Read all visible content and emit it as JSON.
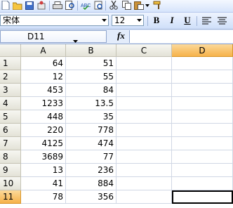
{
  "toolbar": {
    "icons": [
      "new-icon",
      "open-icon",
      "save-icon",
      "permission-icon",
      "print-icon",
      "print-preview-icon",
      "spelling-icon",
      "research-icon",
      "cut-icon",
      "copy-icon",
      "paste-icon",
      "format-painter-icon"
    ]
  },
  "format_bar": {
    "font_name": "宋体",
    "font_size": "12",
    "bold_label": "B",
    "italic_label": "I",
    "underline_label": "U"
  },
  "formula_bar": {
    "name_box": "D11",
    "fx_label": "fx",
    "value": ""
  },
  "sheet": {
    "columns": [
      "A",
      "B",
      "C",
      "D"
    ],
    "selected_column": "D",
    "rows": [
      {
        "num": "1",
        "a": "64",
        "b": "51"
      },
      {
        "num": "2",
        "a": "12",
        "b": "55"
      },
      {
        "num": "3",
        "a": "453",
        "b": "84"
      },
      {
        "num": "4",
        "a": "1233",
        "b": "13.5"
      },
      {
        "num": "5",
        "a": "448",
        "b": "35"
      },
      {
        "num": "6",
        "a": "220",
        "b": "778"
      },
      {
        "num": "7",
        "a": "4125",
        "b": "474"
      },
      {
        "num": "8",
        "a": "3689",
        "b": "77"
      },
      {
        "num": "9",
        "a": "13",
        "b": "236"
      },
      {
        "num": "10",
        "a": "41",
        "b": "884"
      },
      {
        "num": "11",
        "a": "78",
        "b": "356"
      }
    ],
    "selected_row": "11",
    "active_cell": "D11"
  }
}
